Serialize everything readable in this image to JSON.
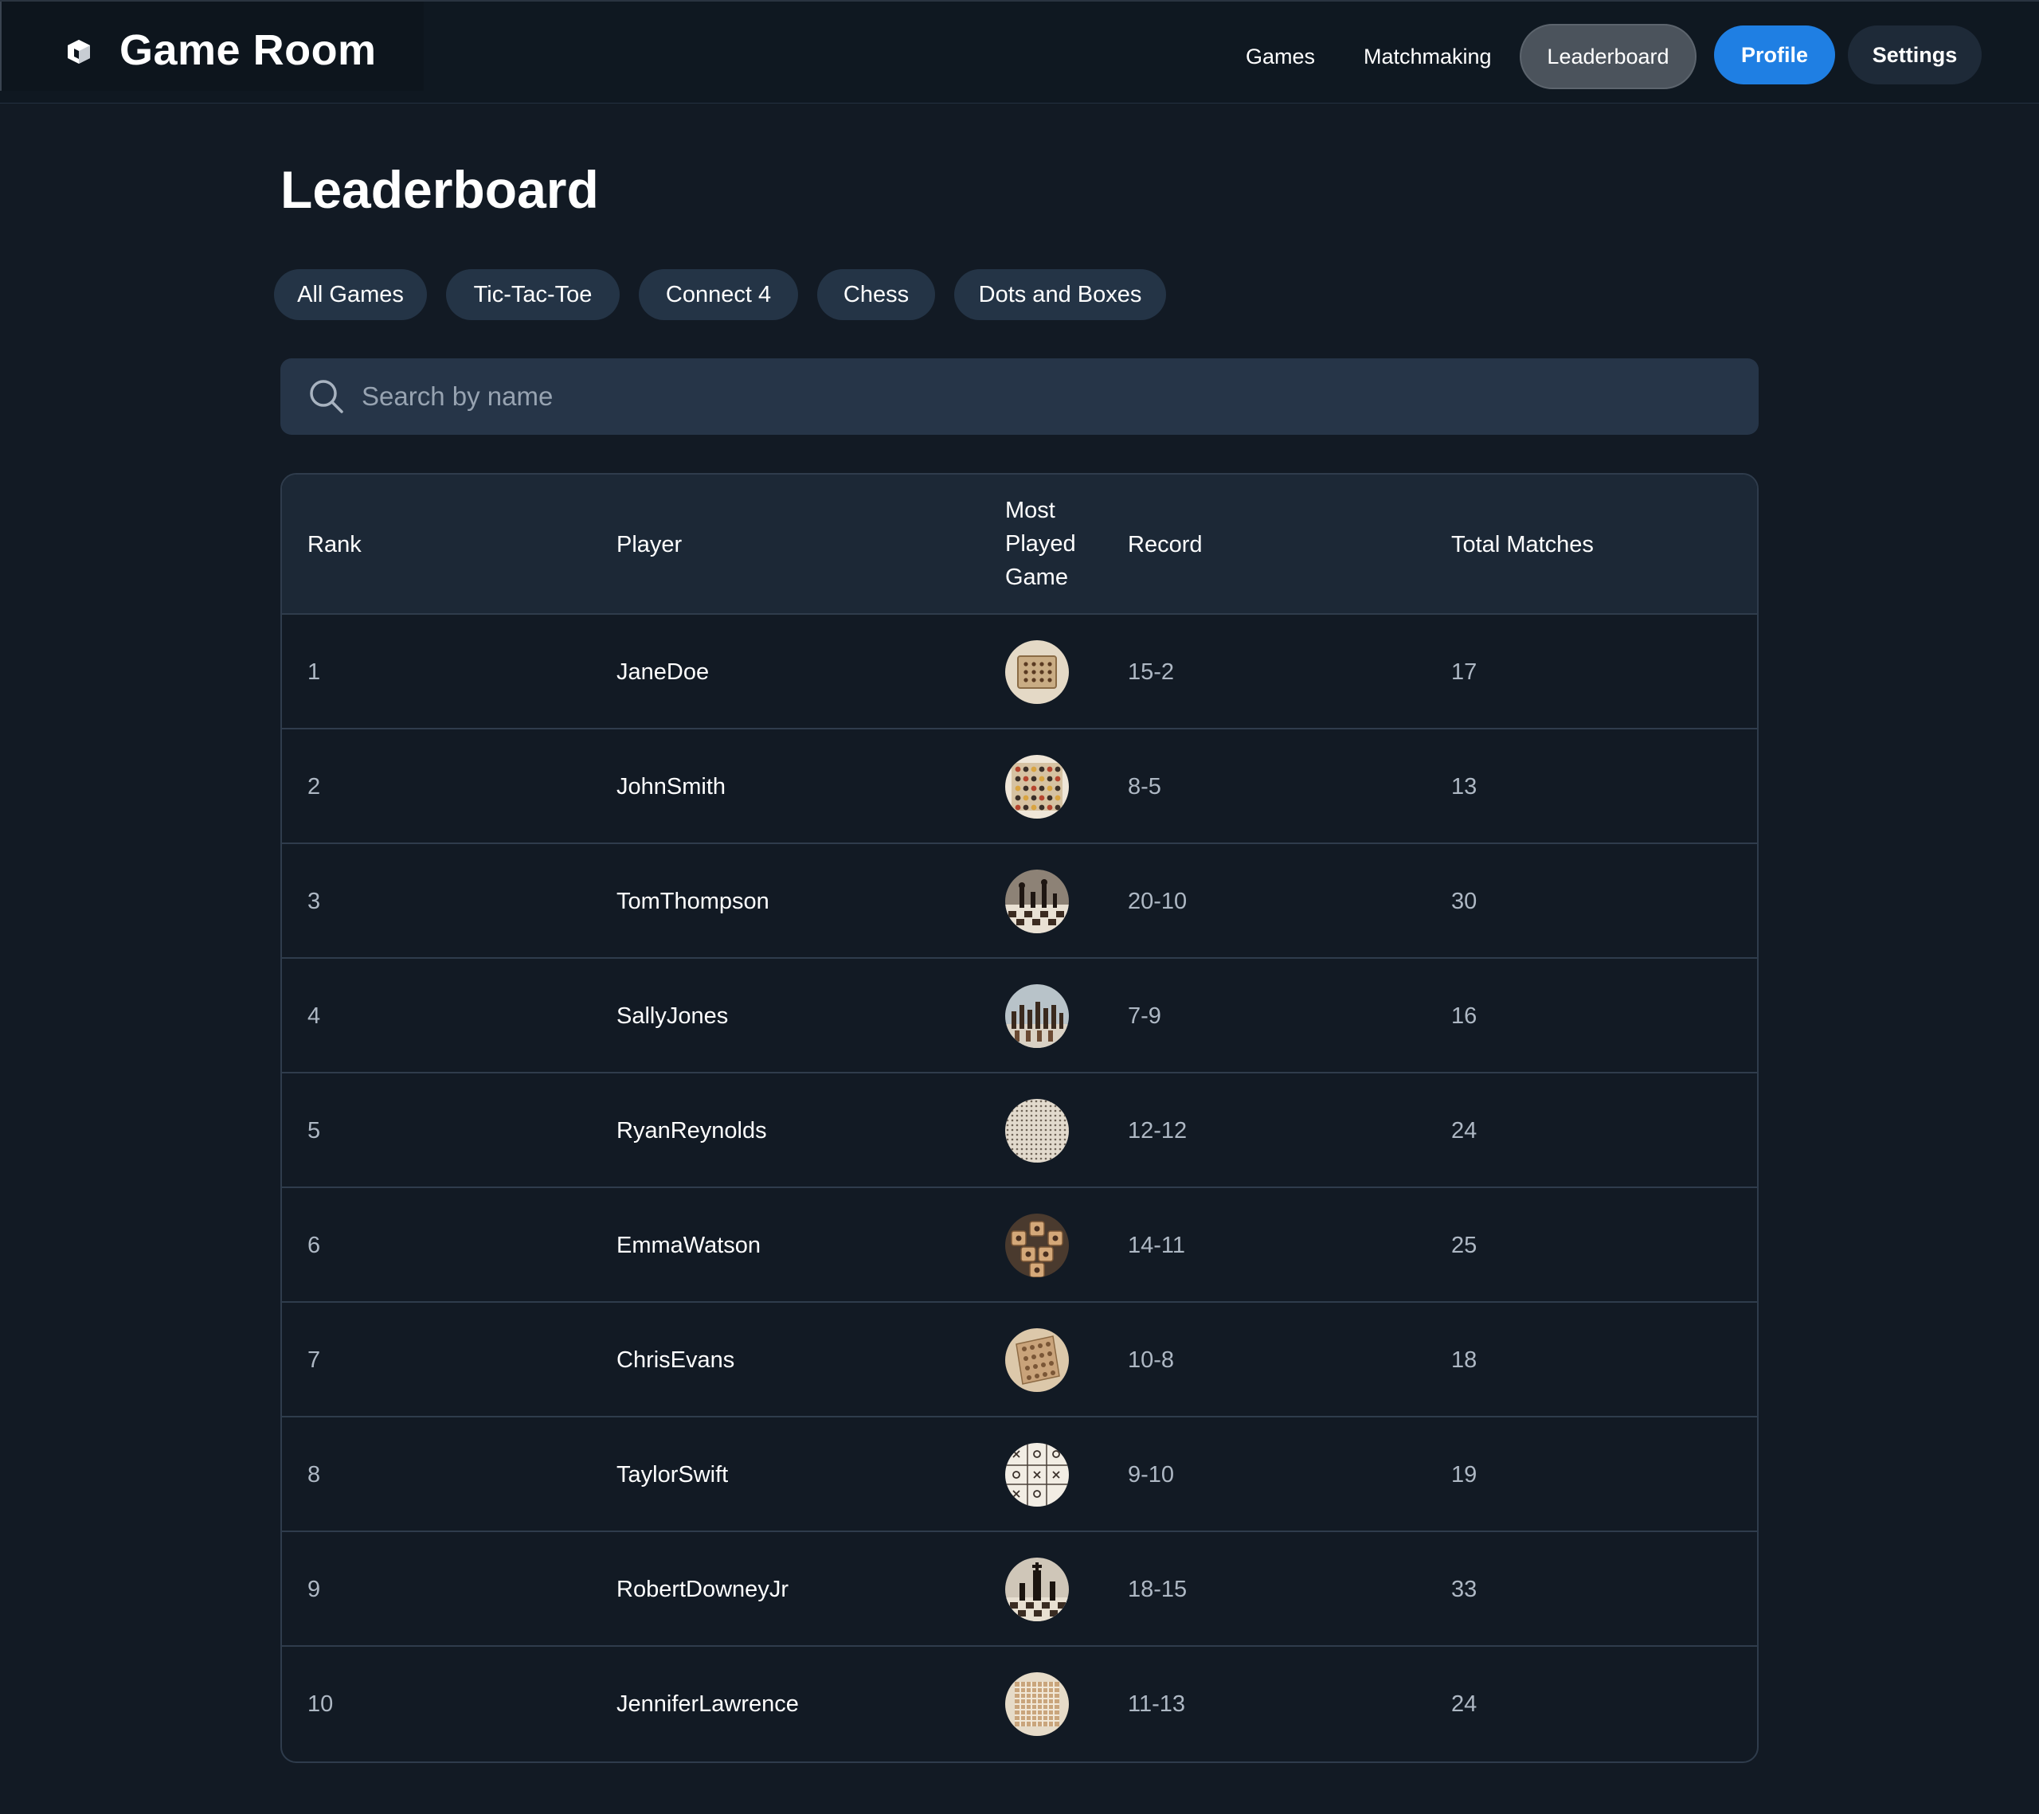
{
  "header": {
    "app_title": "Game Room",
    "logo_icon": "cube-icon",
    "nav": {
      "games": "Games",
      "matchmaking": "Matchmaking",
      "leaderboard": "Leaderboard",
      "profile": "Profile",
      "settings": "Settings"
    },
    "active_nav": "Leaderboard",
    "accent_color": "#1f7fe3"
  },
  "page": {
    "title": "Leaderboard"
  },
  "filters": [
    "All Games",
    "Tic-Tac-Toe",
    "Connect 4",
    "Chess",
    "Dots and Boxes"
  ],
  "search": {
    "placeholder": "Search by name",
    "value": ""
  },
  "table": {
    "columns": {
      "rank": "Rank",
      "player": "Player",
      "most_played_line1": "Most",
      "most_played_line2": "Played",
      "most_played_line3": "Game",
      "record": "Record",
      "total": "Total Matches"
    },
    "rows": [
      {
        "rank": "1",
        "player": "JaneDoe",
        "game_icon": "dots-board-thumbnail",
        "record": "15-2",
        "total": "17"
      },
      {
        "rank": "2",
        "player": "JohnSmith",
        "game_icon": "connect4-board-thumbnail",
        "record": "8-5",
        "total": "13"
      },
      {
        "rank": "3",
        "player": "TomThompson",
        "game_icon": "chess-board-thumbnail",
        "record": "20-10",
        "total": "30"
      },
      {
        "rank": "4",
        "player": "SallyJones",
        "game_icon": "chess-pieces-thumbnail",
        "record": "7-9",
        "total": "16"
      },
      {
        "rank": "5",
        "player": "RyanReynolds",
        "game_icon": "dots-grid-thumbnail",
        "record": "12-12",
        "total": "24"
      },
      {
        "rank": "6",
        "player": "EmmaWatson",
        "game_icon": "wooden-blocks-thumbnail",
        "record": "14-11",
        "total": "25"
      },
      {
        "rank": "7",
        "player": "ChrisEvans",
        "game_icon": "connect4-wood-thumbnail",
        "record": "10-8",
        "total": "18"
      },
      {
        "rank": "8",
        "player": "TaylorSwift",
        "game_icon": "tic-tac-toe-thumbnail",
        "record": "9-10",
        "total": "19"
      },
      {
        "rank": "9",
        "player": "RobertDowneyJr",
        "game_icon": "chess-king-thumbnail",
        "record": "18-15",
        "total": "33"
      },
      {
        "rank": "10",
        "player": "JenniferLawrence",
        "game_icon": "wood-grid-thumbnail",
        "record": "11-13",
        "total": "24"
      }
    ]
  }
}
